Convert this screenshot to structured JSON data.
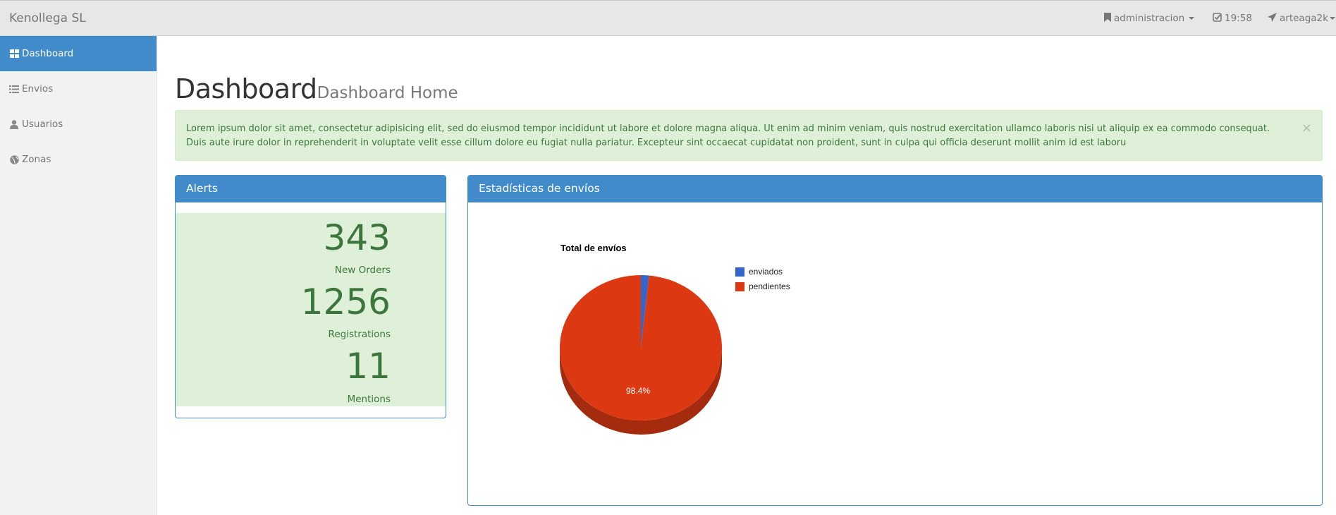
{
  "navbar": {
    "brand": "Kenollega SL",
    "admin_label": "administracion",
    "time_label": "19:58",
    "user_label": "arteaga2k"
  },
  "sidebar": {
    "items": [
      {
        "label": "Dashboard",
        "icon": "grid-icon"
      },
      {
        "label": "Envios",
        "icon": "list-icon"
      },
      {
        "label": "Usuarios",
        "icon": "user-icon"
      },
      {
        "label": "Zonas",
        "icon": "globe-icon"
      }
    ]
  },
  "page": {
    "title": "Dashboard",
    "subtitle": "Dashboard Home"
  },
  "alert": {
    "text": "Lorem ipsum dolor sit amet, consectetur adipisicing elit, sed do eiusmod tempor incididunt ut labore et dolore magna aliqua. Ut enim ad minim veniam, quis nostrud exercitation ullamco laboris nisi ut aliquip ex ea commodo consequat. Duis aute irure dolor in reprehenderit in voluptate velit esse cillum dolore eu fugiat nulla pariatur. Excepteur sint occaecat cupidatat non proident, sunt in culpa qui officia deserunt mollit anim id est laboru",
    "close": "×"
  },
  "alerts_panel": {
    "title": "Alerts",
    "stats": [
      {
        "value": "343",
        "label": "New Orders"
      },
      {
        "value": "1256",
        "label": "Registrations"
      },
      {
        "value": "11",
        "label": "Mentions"
      }
    ]
  },
  "stats_panel": {
    "title": "Estadísticas de envíos"
  },
  "chart_data": {
    "type": "pie",
    "title": "Total de envíos",
    "labels": [
      "enviados",
      "pendientes"
    ],
    "values": [
      1.6,
      98.4
    ],
    "colors": [
      "#3366cc",
      "#dc3912"
    ],
    "slice_label": "98.4%",
    "legend_position": "right",
    "three_d": true
  }
}
